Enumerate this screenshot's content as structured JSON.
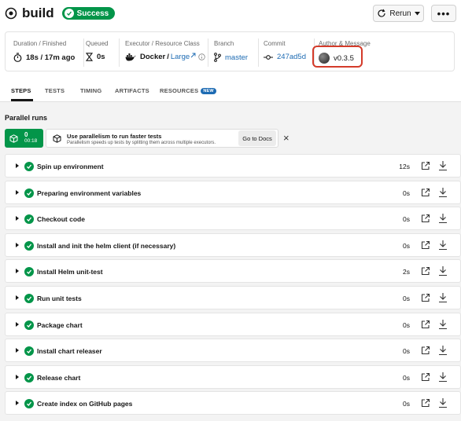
{
  "job": {
    "title": "build",
    "status": "Success"
  },
  "actions": {
    "rerun_label": "Rerun",
    "more_label": "•••"
  },
  "info": {
    "duration_label": "Duration / Finished",
    "duration_value": "18s / 17m ago",
    "queued_label": "Queued",
    "queued_value": "0s",
    "executor_label": "Executor / Resource Class",
    "executor_value": "Docker",
    "resource_class": "Large",
    "branch_label": "Branch",
    "branch_value": "master",
    "commit_label": "Commit",
    "commit_value": "247ad5d",
    "author_label": "Author & Message",
    "author_message": "v0.3.5"
  },
  "tabs": [
    {
      "label": "STEPS",
      "active": true
    },
    {
      "label": "TESTS"
    },
    {
      "label": "TIMING"
    },
    {
      "label": "ARTIFACTS"
    },
    {
      "label": "RESOURCES",
      "badge": "NEW"
    }
  ],
  "parallel": {
    "title": "Parallel runs",
    "count": "0",
    "time": "00:18",
    "promo_title": "Use parallelism to run faster tests",
    "promo_desc": "Parallelism speeds up tests by splitting them across multiple executors.",
    "docs_label": "Go to Docs",
    "close_label": "×"
  },
  "steps": [
    {
      "name": "Spin up environment",
      "duration": "12s"
    },
    {
      "name": "Preparing environment variables",
      "duration": "0s"
    },
    {
      "name": "Checkout code",
      "duration": "0s"
    },
    {
      "name": "Install and init the helm client (if necessary)",
      "duration": "0s"
    },
    {
      "name": "Install Helm unit-test",
      "duration": "2s"
    },
    {
      "name": "Run unit tests",
      "duration": "0s"
    },
    {
      "name": "Package chart",
      "duration": "0s"
    },
    {
      "name": "Install chart releaser",
      "duration": "0s"
    },
    {
      "name": "Release chart",
      "duration": "0s"
    },
    {
      "name": "Create index on GitHub pages",
      "duration": "0s"
    }
  ],
  "colors": {
    "success": "#039549",
    "link": "#1d6bb3",
    "highlight": "#d43b2a"
  }
}
